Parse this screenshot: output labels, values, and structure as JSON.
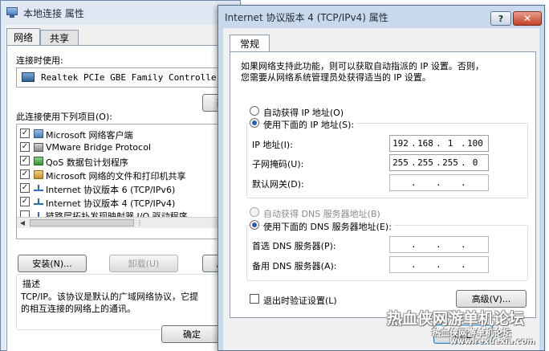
{
  "back_dialog": {
    "title": "本地连接 属性",
    "tabs": [
      {
        "label": "网络",
        "active": true
      },
      {
        "label": "共享",
        "active": false
      }
    ],
    "connect_using_label": "连接时使用:",
    "adapter_name": "Realtek PCIe GBE Family Controller",
    "configure_button_partial": "西",
    "items_label": "此连接使用下列项目(O):",
    "items": [
      {
        "label": "Microsoft 网络客户端",
        "checked": true,
        "icon": "network-client-icon"
      },
      {
        "label": "VMware Bridge Protocol",
        "checked": true,
        "icon": "vmware-bridge-icon"
      },
      {
        "label": "QoS 数据包计划程序",
        "checked": true,
        "icon": "qos-icon"
      },
      {
        "label": "Microsoft 网络的文件和打印机共享",
        "checked": true,
        "icon": "file-share-icon"
      },
      {
        "label": "Internet 协议版本 6 (TCP/IPv6)",
        "checked": true,
        "icon": "protocol-icon"
      },
      {
        "label": "Internet 协议版本 4 (TCP/IPv4)",
        "checked": true,
        "icon": "protocol-icon"
      },
      {
        "label": "链路层拓扑发现映射器 I/O 驱动程序",
        "checked": false,
        "icon": "protocol-icon"
      }
    ],
    "install_button": "安装(N)...",
    "uninstall_button": "卸载(U)",
    "properties_button_partial": "属",
    "description_label": "描述",
    "description_text_1": "TCP/IP。该协议是默认的广域网络协议，它提",
    "description_text_2": "的相互连接的网络上的通讯。",
    "ok_button": "确定"
  },
  "front_dialog": {
    "title": "Internet 协议版本 4 (TCP/IPv4) 属性",
    "help_button": "?",
    "close_button": "✕",
    "tab_general": "常规",
    "intro_line_1": "如果网络支持此功能，则可以获取自动指派的 IP 设置。否则，",
    "intro_line_2": "您需要从网络系统管理员处获得适当的 IP 设置。",
    "auto_ip_option": "自动获得 IP 地址(O)",
    "manual_ip_option": "使用下面的 IP 地址(S):",
    "ip_address_label": "IP 地址(I):",
    "ip_address": [
      "192",
      "168",
      "1",
      "100"
    ],
    "subnet_mask_label": "子网掩码(U):",
    "subnet_mask": [
      "255",
      "255",
      "255",
      "0"
    ],
    "gateway_label": "默认网关(D):",
    "gateway": [
      "",
      "",
      "",
      ""
    ],
    "auto_dns_option": "自动获得 DNS 服务器地址(B)",
    "manual_dns_option": "使用下面的 DNS 服务器地址(E):",
    "preferred_dns_label": "首选 DNS 服务器(P):",
    "preferred_dns": [
      "",
      "",
      "",
      ""
    ],
    "alternate_dns_label": "备用 DNS 服务器(A):",
    "alternate_dns": [
      "",
      "",
      "",
      ""
    ],
    "validate_on_exit": "退出时验证设置(L)",
    "validate_checked": false,
    "advanced_button": "高级(V)...",
    "ok_button_partial": "确定"
  },
  "watermark": {
    "text": "热血侠网游单机论坛",
    "line2": "热血侠网游单机论坛",
    "line3": "www.rexuexia.com"
  },
  "colors": {
    "title_bar": "#c9d9ec",
    "client_bg": "#f0f0f0",
    "radio_dot": "#2a5bb0"
  }
}
